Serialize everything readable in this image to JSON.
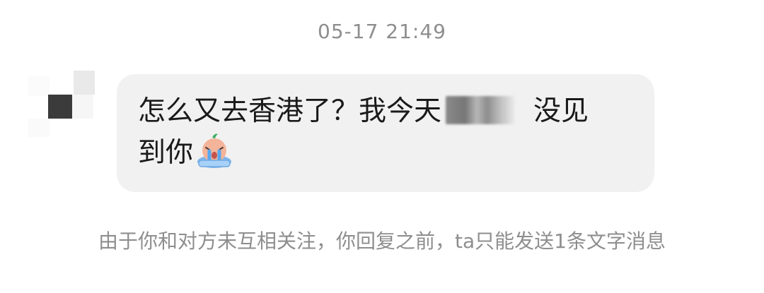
{
  "chat": {
    "timestamp": "05-17 21:49",
    "message": {
      "text_before_redaction": "怎么又去香港了？我今天",
      "text_after_redaction": "没见",
      "text_second_line": "到你",
      "redaction": "blurred-text",
      "emoji": "crying-face-emoji"
    },
    "notice": "由于你和对方未互相关注，你回复之前，ta只能发送1条文字消息"
  },
  "colors": {
    "bubble_background": "#f1f1f1",
    "system_text": "#8e8e8e",
    "message_text": "#1a1a1a"
  }
}
